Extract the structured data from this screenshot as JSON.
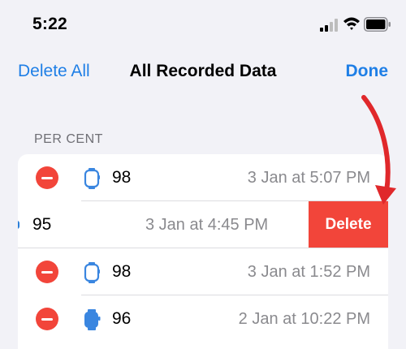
{
  "status_bar": {
    "time": "5:22"
  },
  "nav": {
    "left_label": "Delete All",
    "title": "All Recorded Data",
    "right_label": "Done"
  },
  "section": {
    "header": "PER CENT"
  },
  "entries": [
    {
      "value": "98",
      "date": "3 Jan at 5:07 PM",
      "icon": "watch-outline-icon"
    },
    {
      "value": "95",
      "date": "3 Jan at 4:45 PM",
      "swiped": true,
      "action_label": "Delete"
    },
    {
      "value": "98",
      "date": "3 Jan at 1:52 PM",
      "icon": "watch-outline-icon"
    },
    {
      "value": "96",
      "date": "2 Jan at 10:22 PM",
      "icon": "watch-filled-icon"
    }
  ],
  "colors": {
    "accent": "#1f7fe6",
    "destructive": "#f2453a",
    "arrow": "#e0282b"
  }
}
